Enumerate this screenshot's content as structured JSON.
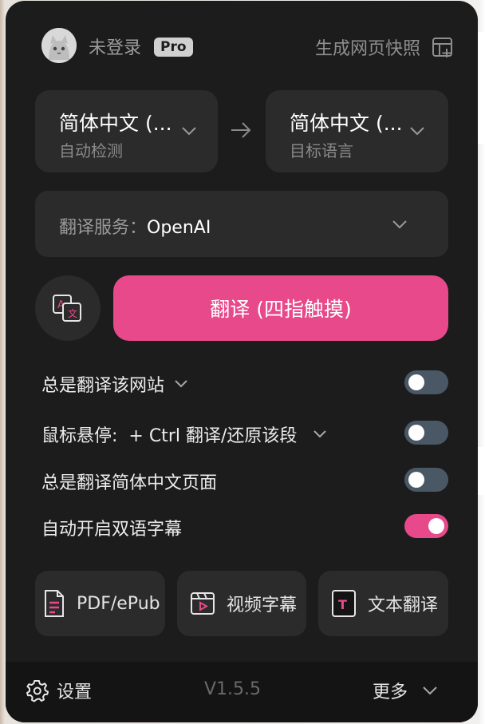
{
  "header": {
    "login_status": "未登录",
    "badge": "Pro",
    "snapshot_label": "生成网页快照"
  },
  "languages": {
    "source": {
      "value": "简体中文 (...",
      "hint": "自动检测"
    },
    "target": {
      "value": "简体中文 (...",
      "hint": "目标语言"
    }
  },
  "service": {
    "label": "翻译服务：",
    "value": "OpenAI"
  },
  "translate_button": "翻译 (四指触摸)",
  "options": [
    {
      "label": "总是翻译该网站",
      "enabled": false
    },
    {
      "label": "鼠标悬停:  + Ctrl 翻译/还原该段",
      "enabled": false
    },
    {
      "label": "总是翻译简体中文页面",
      "enabled": false
    },
    {
      "label": "自动开启双语字幕",
      "enabled": true
    }
  ],
  "tools": [
    {
      "label": "PDF/ePub",
      "icon": "document-icon"
    },
    {
      "label": "视频字幕",
      "icon": "video-subtitle-icon"
    },
    {
      "label": "文本翻译",
      "icon": "text-translate-icon"
    }
  ],
  "footer": {
    "settings_label": "设置",
    "version": "V1.5.5",
    "more_label": "更多"
  },
  "colors": {
    "accent": "#e8498a",
    "panel": "#1c1c1d",
    "card": "#2b2b2c"
  }
}
